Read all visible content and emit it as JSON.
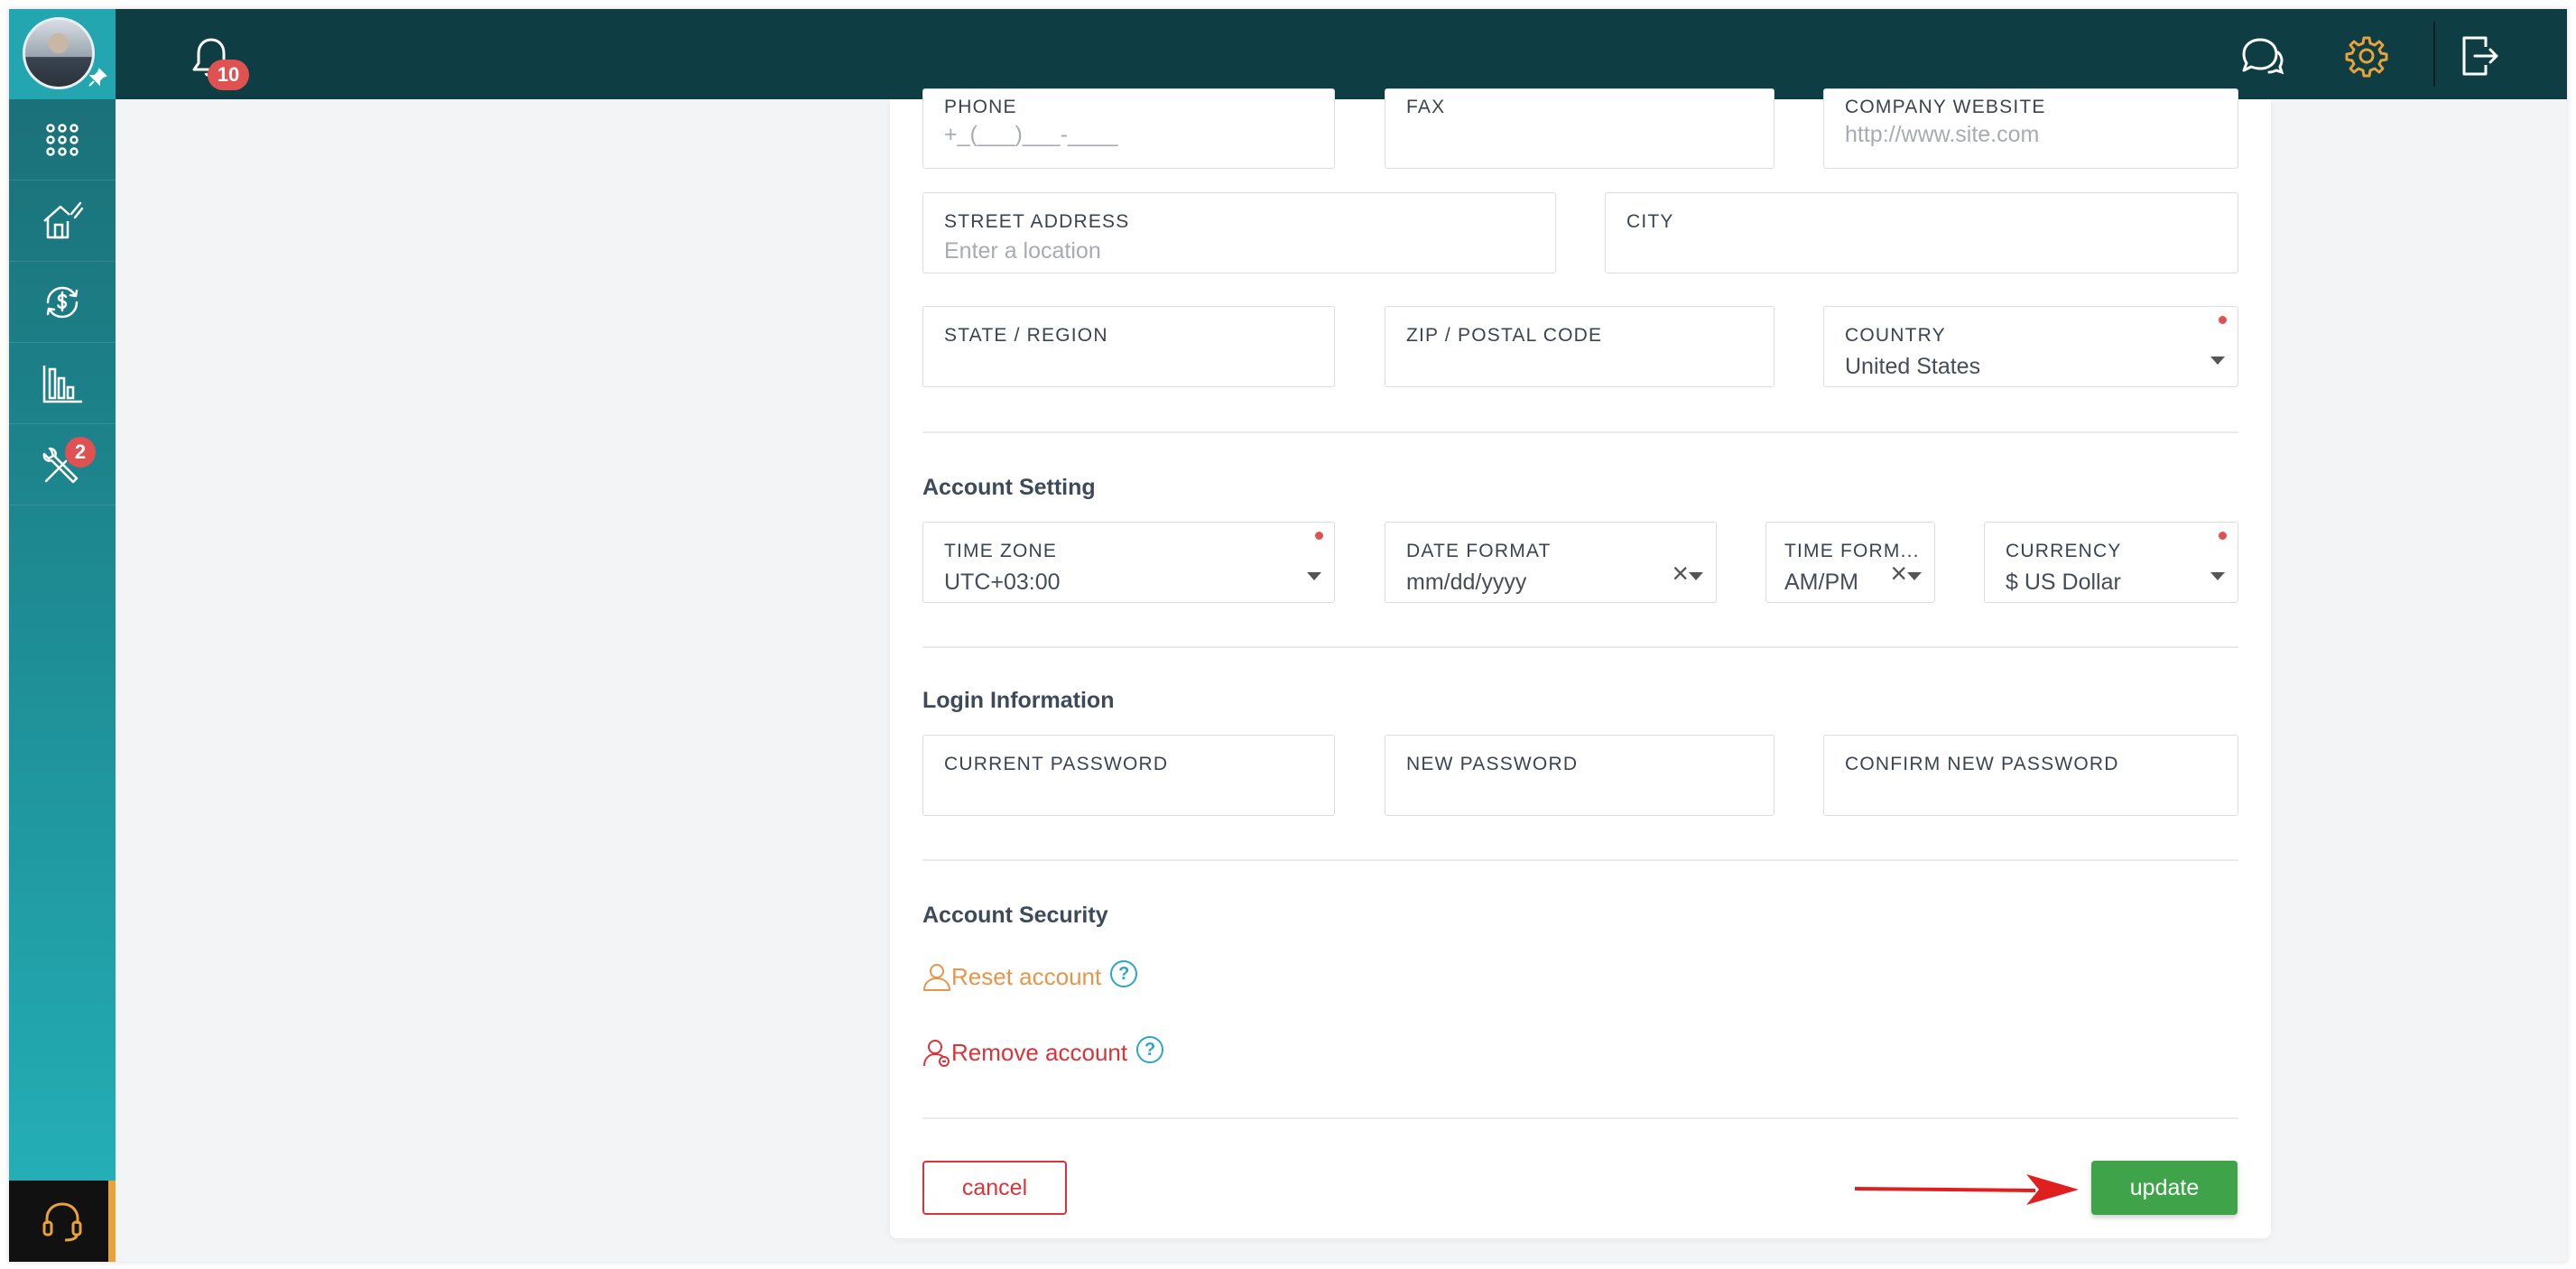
{
  "topbar": {
    "notification_count": "10",
    "icons": [
      "bell-icon",
      "chat-icon",
      "gear-icon",
      "logout-icon"
    ],
    "colors": {
      "background": "#0e3d44",
      "gear": "#e8a23a"
    }
  },
  "sidebar": {
    "items": [
      {
        "icon": "apps-grid-icon"
      },
      {
        "icon": "home-edit-icon"
      },
      {
        "icon": "dollar-cycle-icon"
      },
      {
        "icon": "bar-chart-icon"
      },
      {
        "icon": "tools-icon",
        "badge": "2"
      }
    ],
    "support_icon": "headset-icon"
  },
  "contact": {
    "phone": {
      "label": "PHONE",
      "placeholder": "+_(___)___-____"
    },
    "fax": {
      "label": "FAX",
      "value": ""
    },
    "website": {
      "label": "COMPANY WEBSITE",
      "placeholder": "http://www.site.com"
    },
    "street": {
      "label": "STREET ADDRESS",
      "placeholder": "Enter a location"
    },
    "city": {
      "label": "CITY",
      "value": ""
    },
    "state": {
      "label": "STATE / REGION",
      "value": ""
    },
    "zip": {
      "label": "ZIP / POSTAL CODE",
      "value": ""
    },
    "country": {
      "label": "COUNTRY",
      "value": "United States"
    }
  },
  "account_setting": {
    "title": "Account Setting",
    "time_zone": {
      "label": "TIME ZONE",
      "value": "UTC+03:00"
    },
    "date_format": {
      "label": "DATE FORMAT",
      "value": "mm/dd/yyyy"
    },
    "time_format": {
      "label": "TIME FORM...",
      "value": "AM/PM"
    },
    "currency": {
      "label": "CURRENCY",
      "value": "$ US Dollar"
    }
  },
  "login": {
    "title": "Login Information",
    "current": {
      "label": "CURRENT PASSWORD"
    },
    "new": {
      "label": "NEW PASSWORD"
    },
    "confirm": {
      "label": "CONFIRM NEW PASSWORD"
    }
  },
  "security": {
    "title": "Account Security",
    "reset_label": "Reset account",
    "remove_label": "Remove account",
    "help": "?"
  },
  "actions": {
    "cancel_label": "cancel",
    "update_label": "update"
  }
}
